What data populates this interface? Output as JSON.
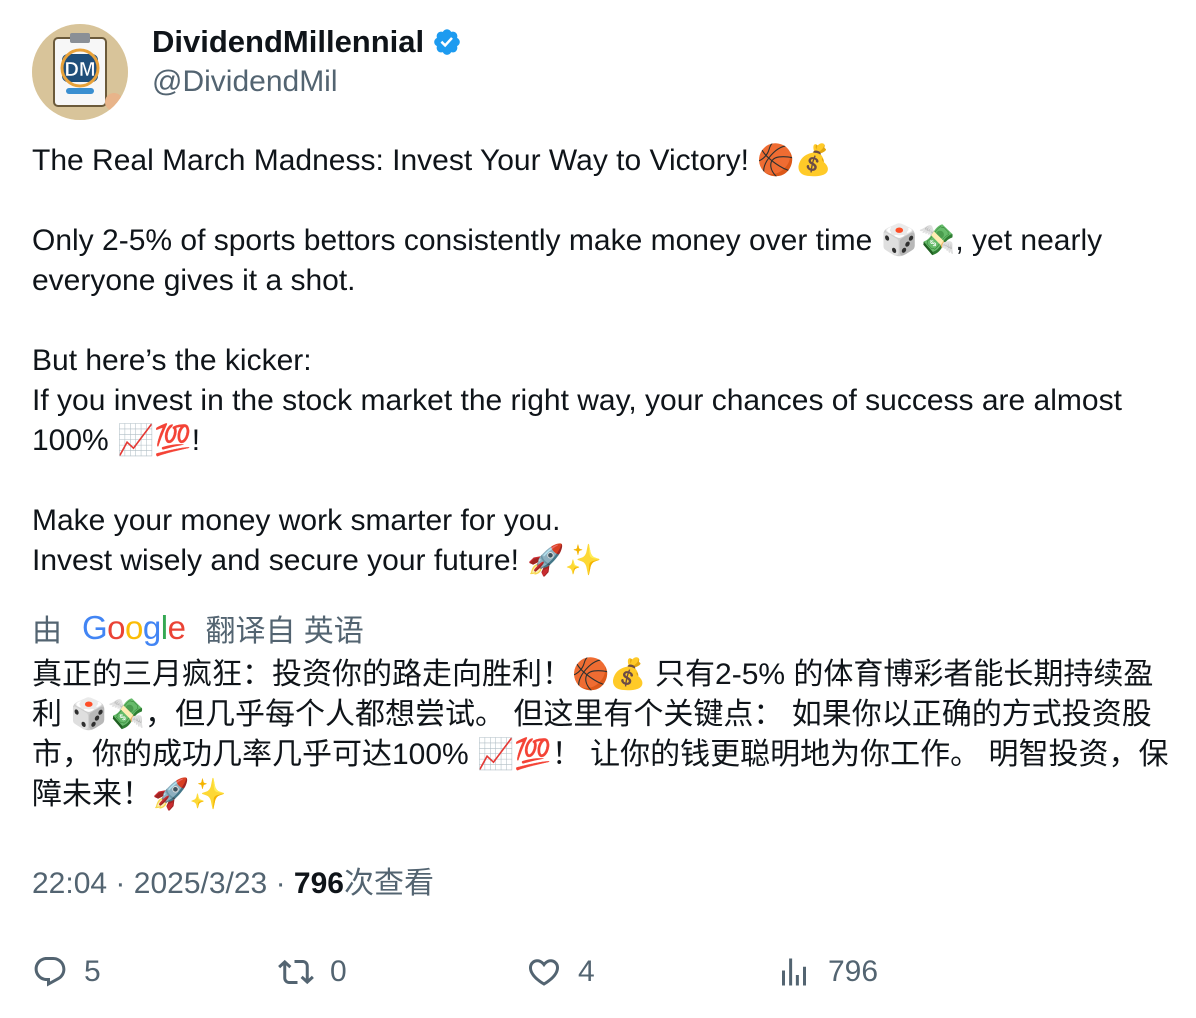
{
  "author": {
    "display_name": "DividendMillennial",
    "handle": "@DividendMil",
    "avatar_text": "DM",
    "verified_icon": "verified-badge-icon",
    "verified_color": "#1d9bf0"
  },
  "tweet": {
    "text": "The Real March Madness: Invest Your Way to Victory! 🏀💰\n\nOnly 2-5% of sports bettors consistently make money over time 🎲💸, yet nearly everyone gives it a shot.\n\nBut here’s the kicker:\nIf you invest in the stock market the right way, your chances of success are almost 100% 📈💯!\n\nMake your money work smarter for you.\nInvest wisely and secure your future! 🚀✨"
  },
  "translation": {
    "prefix": "由",
    "google_letters": [
      {
        "ch": "G",
        "color": "#4285F4"
      },
      {
        "ch": "o",
        "color": "#EA4335"
      },
      {
        "ch": "o",
        "color": "#FBBC05"
      },
      {
        "ch": "g",
        "color": "#4285F4"
      },
      {
        "ch": "l",
        "color": "#34A853"
      },
      {
        "ch": "e",
        "color": "#EA4335"
      }
    ],
    "suffix": "翻译自 英语",
    "text": "真正的三月疯狂：投资你的路走向胜利！🏀💰 只有2-5% 的体育博彩者能长期持续盈利 🎲💸，但几乎每个人都想尝试。 但这里有个关键点： 如果你以正确的方式投资股市，你的成功几率几乎可达100% 📈💯！ 让你的钱更聪明地为你工作。 明智投资，保障未来！🚀✨"
  },
  "meta": {
    "time": "22:04",
    "separator": "·",
    "date": "2025/3/23",
    "views_count": "796",
    "views_label": "次查看"
  },
  "actions": {
    "reply": {
      "icon": "reply-icon",
      "count": "5"
    },
    "retweet": {
      "icon": "retweet-icon",
      "count": "0"
    },
    "like": {
      "icon": "heart-icon",
      "count": "4"
    },
    "views": {
      "icon": "analytics-icon",
      "count": "796"
    }
  },
  "colors": {
    "text_primary": "#0f1419",
    "text_secondary": "#536471",
    "verified": "#1d9bf0"
  }
}
